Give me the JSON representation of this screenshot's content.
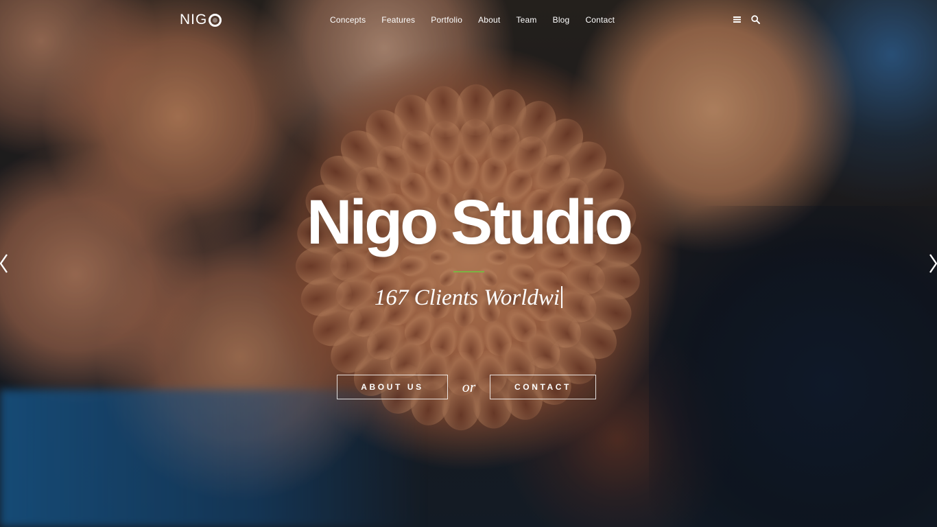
{
  "brand": {
    "logo_text": "NIG",
    "accent_color": "#7cb342"
  },
  "nav": {
    "items": [
      {
        "label": "Concepts"
      },
      {
        "label": "Features"
      },
      {
        "label": "Portfolio"
      },
      {
        "label": "About"
      },
      {
        "label": "Team"
      },
      {
        "label": "Blog"
      },
      {
        "label": "Contact"
      }
    ]
  },
  "header_icons": [
    "menu-icon",
    "search-icon"
  ],
  "hero": {
    "title": "Nigo Studio",
    "subtitle": "167 Clients Worldwi",
    "buttons": {
      "about_label": "ABOUT US",
      "separator": "or",
      "contact_label": "CONTACT"
    }
  },
  "slider": {
    "prev_icon": "chevron-left-icon",
    "next_icon": "chevron-right-icon"
  }
}
